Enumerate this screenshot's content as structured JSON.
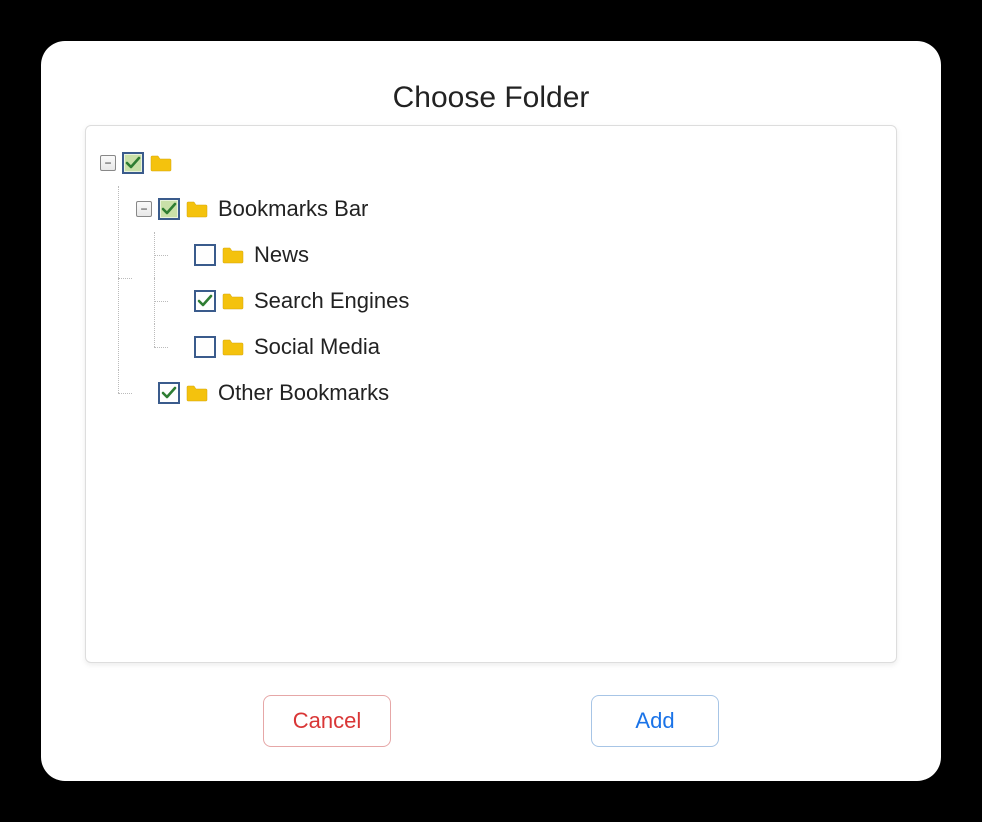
{
  "dialog": {
    "title": "Choose Folder"
  },
  "buttons": {
    "cancel": "Cancel",
    "add": "Add"
  },
  "tree": {
    "root": {
      "label": "",
      "checked": true,
      "highlight": true,
      "expanded": true
    },
    "bookmarks_bar": {
      "label": "Bookmarks Bar",
      "checked": true,
      "highlight": true,
      "expanded": true
    },
    "news": {
      "label": "News",
      "checked": false,
      "highlight": false
    },
    "search_engines": {
      "label": "Search Engines",
      "checked": true,
      "highlight": false
    },
    "social_media": {
      "label": "Social Media",
      "checked": false,
      "highlight": false
    },
    "other_bookmarks": {
      "label": "Other Bookmarks",
      "checked": true,
      "highlight": false
    }
  }
}
